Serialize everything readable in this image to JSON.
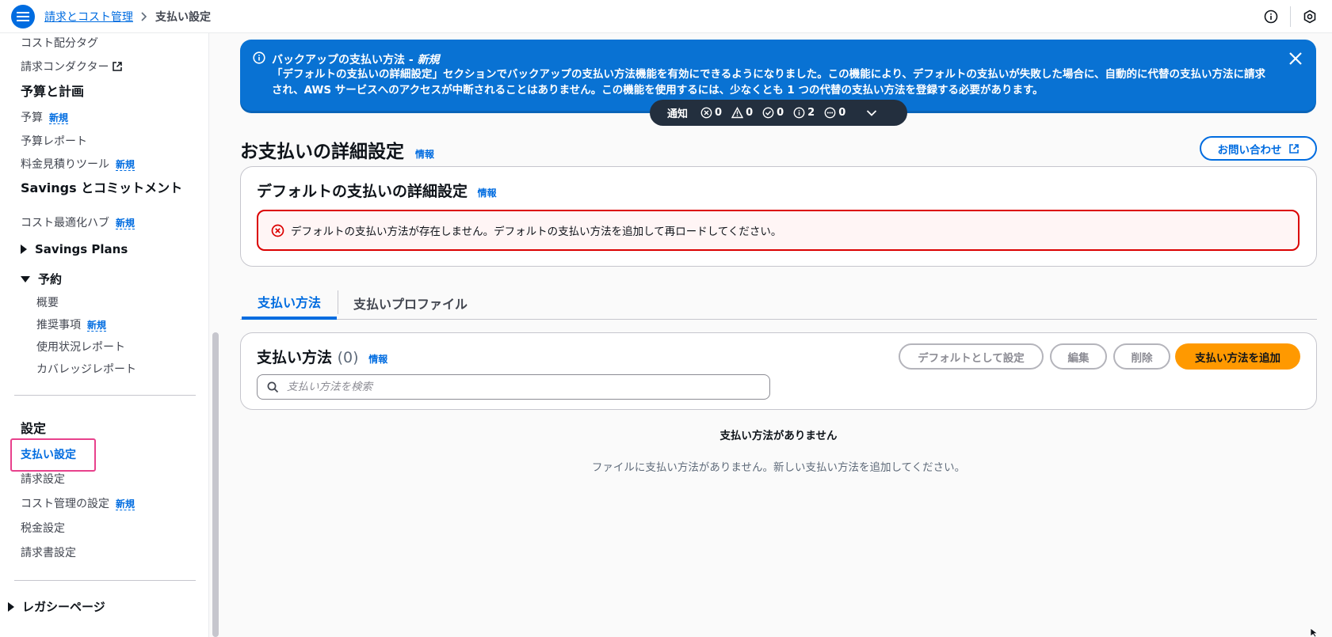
{
  "header": {
    "breadcrumb_parent": "請求とコスト管理",
    "breadcrumb_current": "支払い設定"
  },
  "sidebar": {
    "items_top": [
      "コスト配分タグ",
      "請求コンダクター"
    ],
    "plan_heading": "予算と計画",
    "budget": "予算",
    "budget_reports": "予算レポート",
    "pricing_calculator": "料金見積りツール",
    "savings_heading": "Savings とコミットメント",
    "cost_optimization_hub": "コスト最適化ハブ",
    "savings_plans": "Savings Plans",
    "reservations": "予約",
    "reservations_sub": [
      "概要",
      "推奨事項",
      "使用状況レポート",
      "カバレッジレポート"
    ],
    "settings_heading": "設定",
    "payment_settings": "支払い設定",
    "billing_settings": "請求設定",
    "cost_management_settings": "コスト管理の設定",
    "tax_settings": "税金設定",
    "invoice_settings": "請求書設定",
    "legacy_pages": "レガシーページ",
    "new_badge": "新規"
  },
  "flash": {
    "title": "バックアップの支払い方法 - ",
    "title_new": "新規",
    "text": "「デフォルトの支払いの詳細設定」セクションでバックアップの支払い方法機能を有効にできるようになりました。この機能により、デフォルトの支払いが失敗した場合に、自動的に代替の支払い方法に請求され、AWS サービスへのアクセスが中断されることはありません。この機能を使用するには、少なくとも 1 つの代替の支払い方法を登録する必要があります。"
  },
  "notifications": {
    "label": "通知",
    "error_count": "0",
    "warning_count": "0",
    "success_count": "0",
    "info_count": "2",
    "inprogress_count": "0"
  },
  "page": {
    "title": "お支払いの詳細設定",
    "info": "情報",
    "contact_button": "お問い合わせ"
  },
  "default_settings": {
    "title": "デフォルトの支払いの詳細設定",
    "info": "情報",
    "error_message": "デフォルトの支払い方法が存在しません。デフォルトの支払い方法を追加して再ロードしてください。"
  },
  "tabs": {
    "payment_methods": "支払い方法",
    "payment_profiles": "支払いプロファイル"
  },
  "payment_methods": {
    "title": "支払い方法",
    "count": "(0)",
    "info": "情報",
    "set_default_button": "デフォルトとして設定",
    "edit_button": "編集",
    "delete_button": "削除",
    "add_button": "支払い方法を追加",
    "search_placeholder": "支払い方法を検索",
    "empty_title": "支払い方法がありません",
    "empty_text": "ファイルに支払い方法がありません。新しい支払い方法を追加してください。"
  },
  "colors": {
    "accent": "#006ce0",
    "flash_bg": "#0972d3",
    "primary_button": "#ff9900",
    "error": "#db0000",
    "highlight": "#e8418c"
  }
}
